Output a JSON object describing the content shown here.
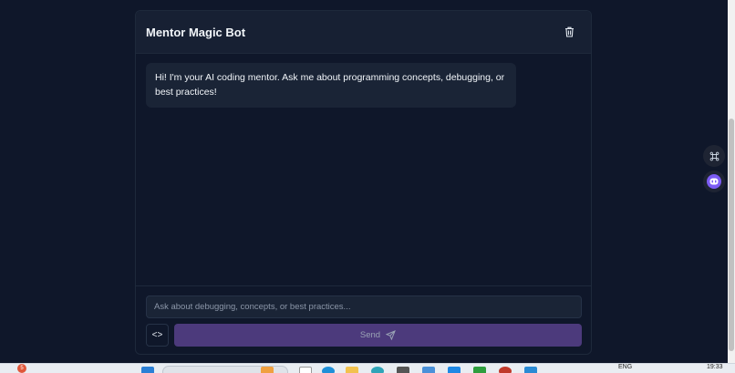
{
  "chat": {
    "title": "Mentor Magic Bot",
    "messages": [
      {
        "role": "bot",
        "text": "Hi! I'm your AI coding mentor. Ask me about programming concepts, debugging, or best practices!"
      }
    ],
    "input_placeholder": "Ask about debugging, concepts, or best practices...",
    "input_value": "",
    "code_toggle_label": "<>",
    "send_label": "Send"
  },
  "icons": {
    "clear": "trash-icon",
    "send": "send-icon",
    "command": "command-icon",
    "assistant": "bot-icon"
  },
  "taskbar": {
    "notification_count": "5",
    "language": "ENG",
    "time": "19:33"
  },
  "colors": {
    "background": "#0f172a",
    "card_header": "#172033",
    "bubble": "#1a2436",
    "send_button": "#4c3a7c",
    "assistant_accent": "#7c5cf4"
  }
}
